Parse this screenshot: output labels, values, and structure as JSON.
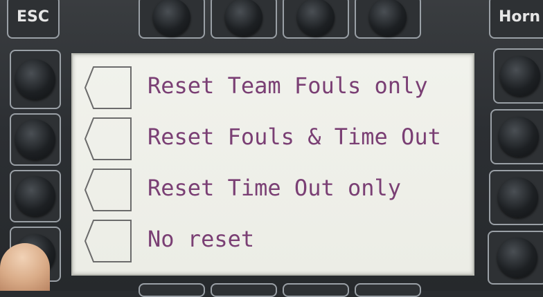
{
  "device": {
    "top_left_key": "ESC",
    "top_right_key": "Horn"
  },
  "menu": {
    "items": [
      {
        "label": "Reset Team Fouls only"
      },
      {
        "label": "Reset Fouls & Time Out"
      },
      {
        "label": "Reset Time Out only"
      },
      {
        "label": "No reset"
      }
    ]
  },
  "colors": {
    "menu_text": "#7a3f74",
    "screen_bg": "#eeefe8",
    "panel": "#2c2f33"
  }
}
